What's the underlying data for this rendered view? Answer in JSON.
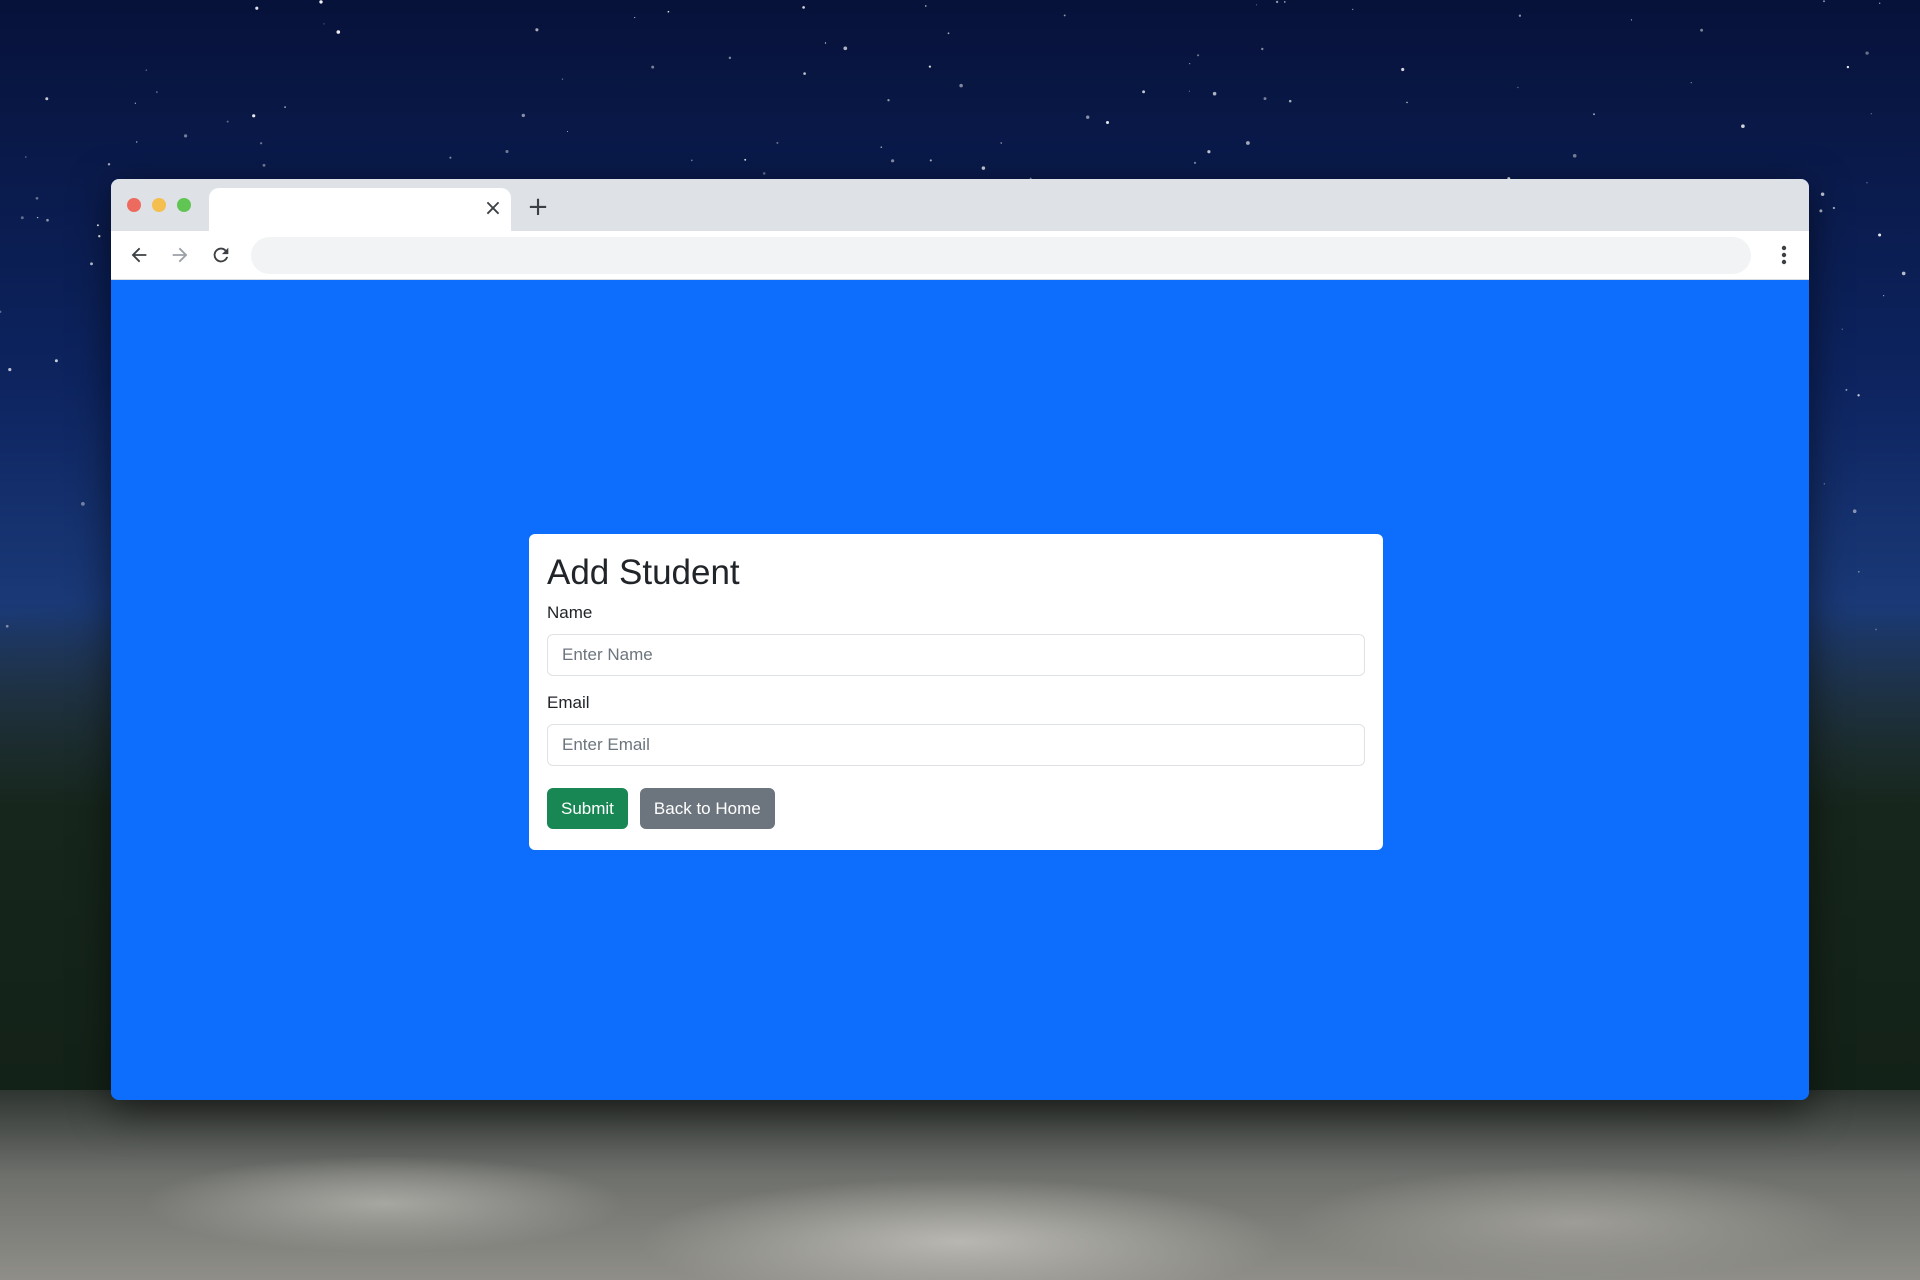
{
  "browser": {
    "tab_title": "",
    "tab_close_icon": "×",
    "new_tab_icon": "+",
    "address": "",
    "controls": [
      "back-arrow-icon",
      "forward-arrow-icon",
      "reload-icon",
      "more-vert-icon"
    ]
  },
  "page": {
    "background_color": "#0d6efd",
    "form": {
      "title": "Add Student",
      "name_label": "Name",
      "name_placeholder": "Enter Name",
      "name_value": "",
      "email_label": "Email",
      "email_placeholder": "Enter Email",
      "email_value": "",
      "submit_label": "Submit",
      "back_label": "Back to Home",
      "submit_color": "#198754",
      "back_color": "#6c757d"
    }
  }
}
